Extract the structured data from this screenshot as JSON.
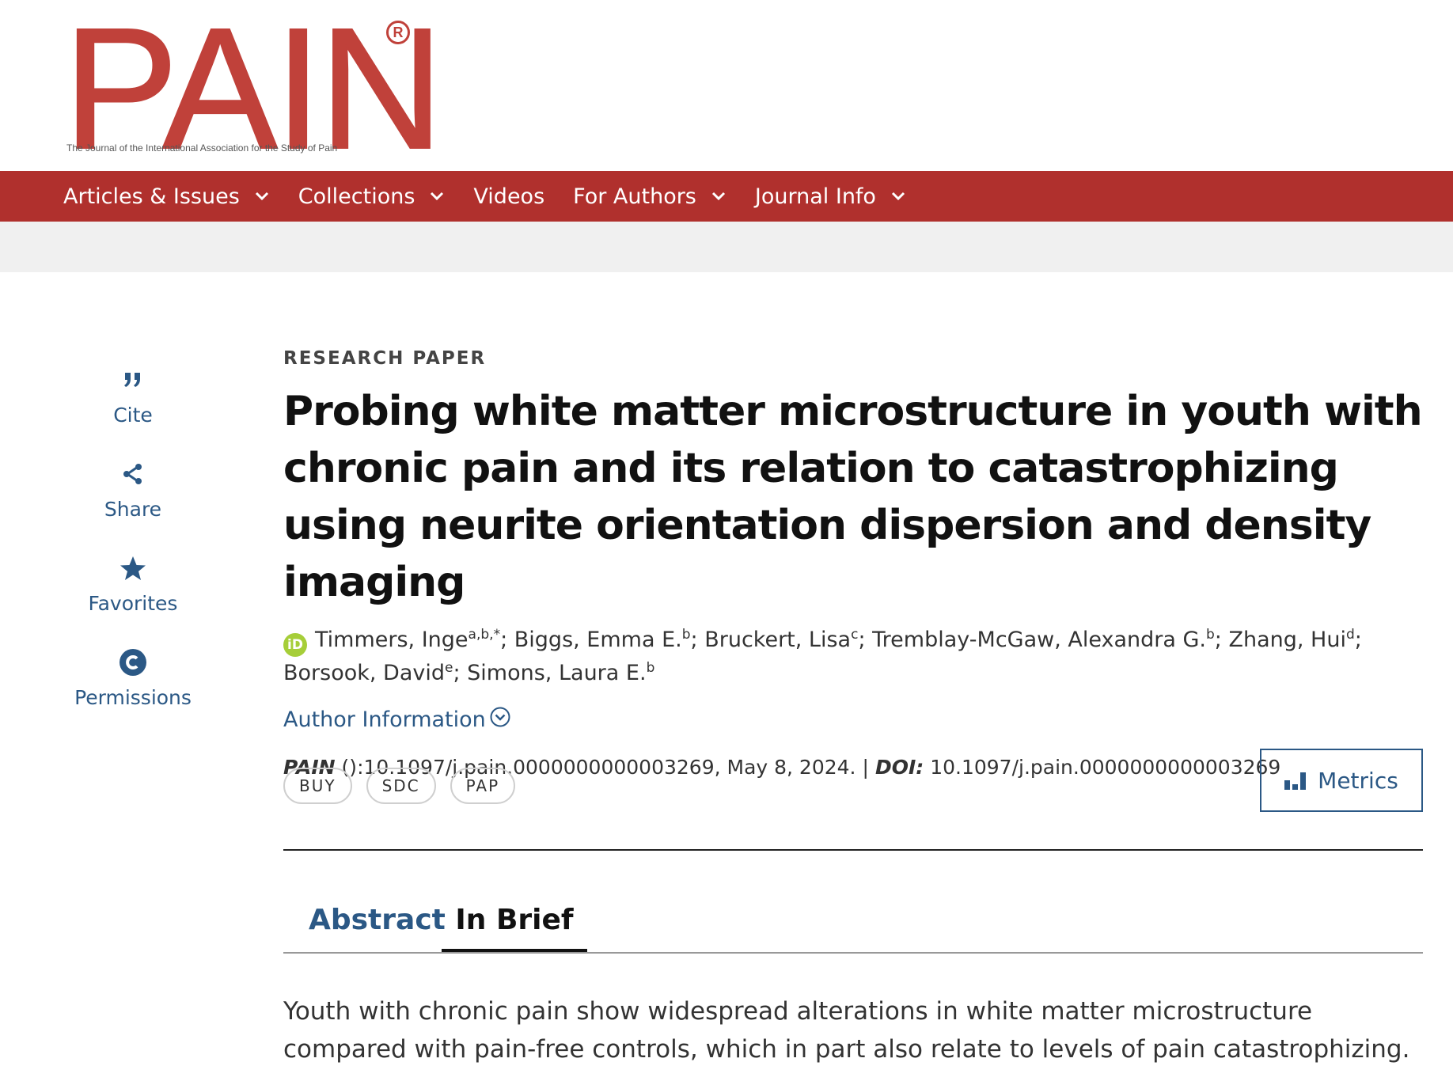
{
  "logo": {
    "wordmark": "PAIN",
    "registered": "R",
    "tagline": "The Journal of the International Association for the Study of Pain"
  },
  "nav": {
    "items": [
      {
        "label": "Articles & Issues",
        "has_dropdown": true
      },
      {
        "label": "Collections",
        "has_dropdown": true
      },
      {
        "label": "Videos",
        "has_dropdown": false
      },
      {
        "label": "For Authors",
        "has_dropdown": true
      },
      {
        "label": "Journal Info",
        "has_dropdown": true
      }
    ]
  },
  "rail": {
    "cite": "Cite",
    "share": "Share",
    "favorites": "Favorites",
    "permissions": "Permissions"
  },
  "article": {
    "kicker": "RESEARCH PAPER",
    "title": "Probing white matter microstructure in youth with chronic pain and its relation to catastrophizing using neurite orientation dispersion and density imaging",
    "authors": [
      {
        "name": "Timmers, Inge",
        "sup": "a,b,*"
      },
      {
        "name": "Biggs, Emma E.",
        "sup": "b"
      },
      {
        "name": "Bruckert, Lisa",
        "sup": "c"
      },
      {
        "name": "Tremblay-McGaw, Alexandra G.",
        "sup": "b"
      },
      {
        "name": "Zhang, Hui",
        "sup": "d"
      },
      {
        "name": "Borsook, David",
        "sup": "e"
      },
      {
        "name": "Simons, Laura E.",
        "sup": "b"
      }
    ],
    "author_info_label": "Author Information",
    "citation": {
      "journal": "PAIN",
      "ref": " ():10.1097/j.pain.0000000000003269, May 8, 2024.",
      "separator": "|",
      "doi_label": "DOI:",
      "doi": "10.1097/j.pain.0000000000003269"
    },
    "pills": [
      "BUY",
      "SDC",
      "PAP"
    ],
    "metrics_label": "Metrics",
    "tabs": {
      "abstract": "Abstract",
      "in_brief": "In Brief",
      "active": "In Brief"
    },
    "brief_text": "Youth with chronic pain show widespread alterations in white matter microstructure compared with pain-free controls, which in part also relate to levels of pain catastrophizing."
  },
  "colors": {
    "brand_red": "#b0302d",
    "logo_red": "#c0413a",
    "link_blue": "#2b5885",
    "orcid_green": "#a6ce39"
  },
  "icons": {
    "cite": "quote-icon",
    "share": "share-icon",
    "favorites": "star-icon",
    "permissions": "copyright-icon",
    "metrics": "bar-chart-icon",
    "author_info": "chevron-circle-down-icon",
    "orcid": "orcid-icon"
  }
}
